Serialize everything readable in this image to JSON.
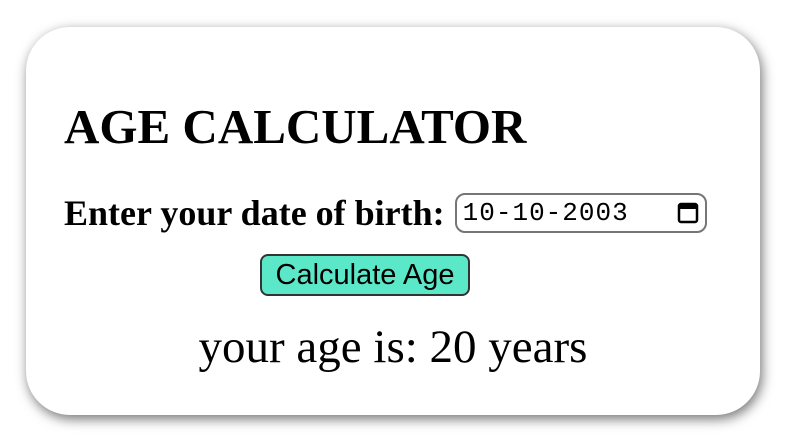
{
  "app": {
    "title": "AGE CALCULATOR"
  },
  "form": {
    "dob_label": "Enter your date of birth:",
    "dob_value": "10-10-2003",
    "calculate_label": "Calculate Age"
  },
  "result": {
    "text": "your age is: 20 years"
  },
  "icons": {
    "date_picker": "calendar-icon"
  },
  "colors": {
    "button_bg": "#5be8c8",
    "card_bg": "#ffffff"
  }
}
